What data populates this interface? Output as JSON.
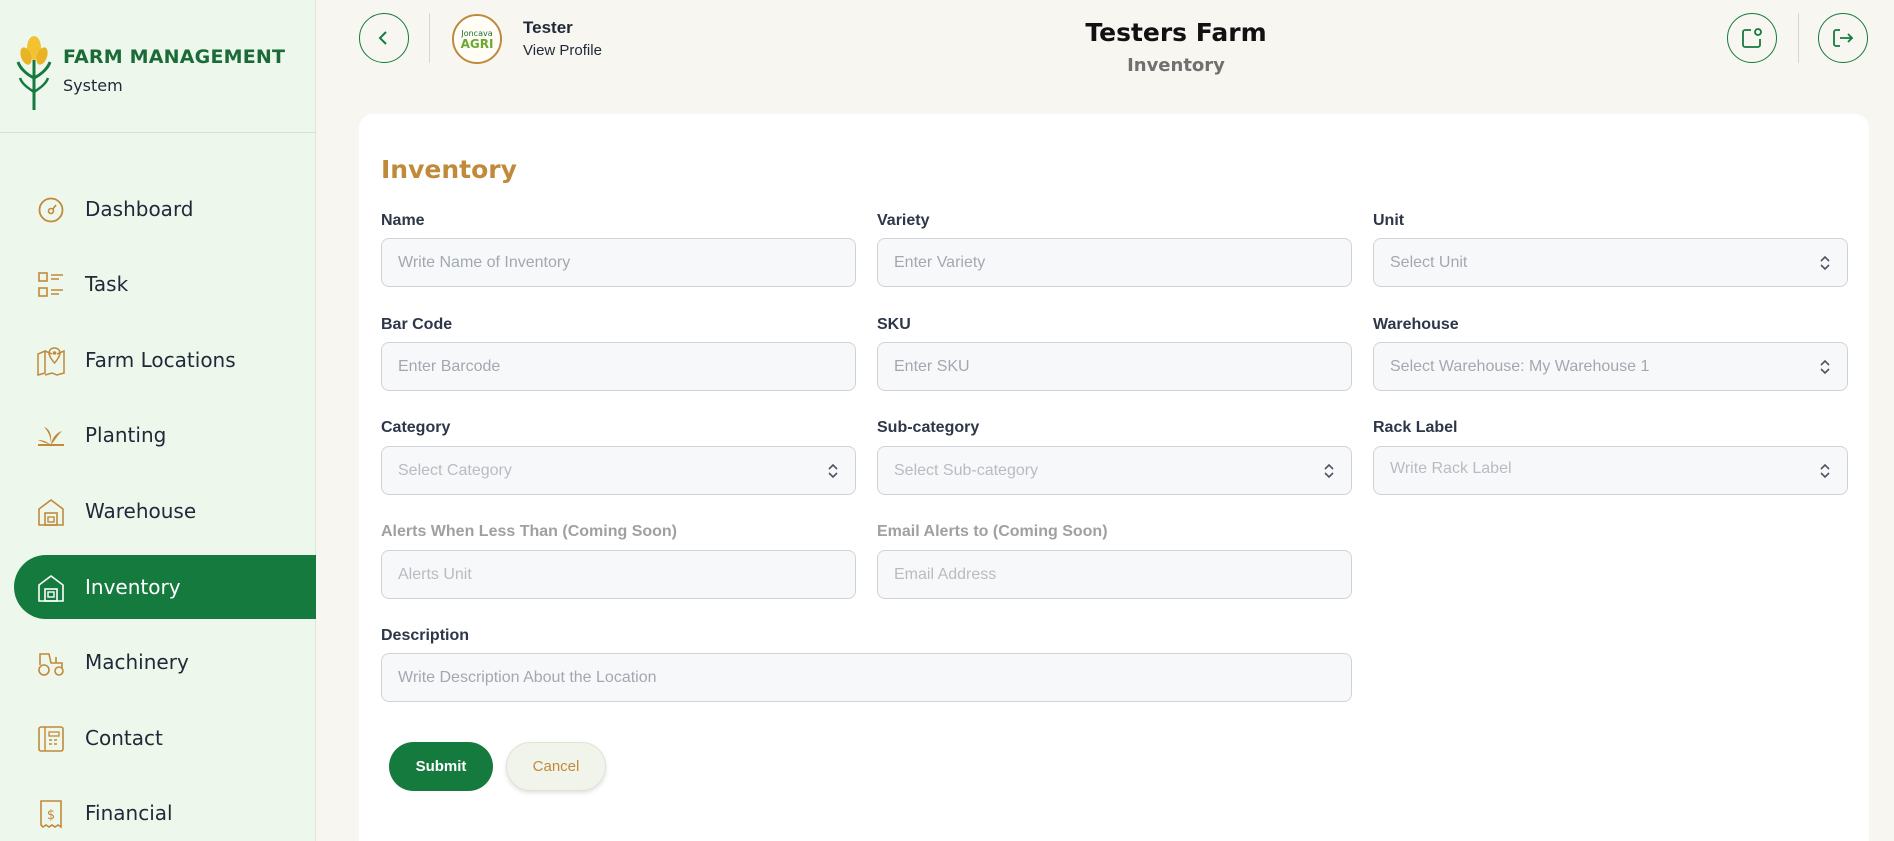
{
  "brand": {
    "title": "FARM MANAGEMENT",
    "subtitle": "System",
    "accent": "#157a3e",
    "gold": "#c08a3a"
  },
  "sidebar": {
    "items": [
      {
        "label": "Dashboard",
        "icon": "dashboard-gauge-icon",
        "active": false
      },
      {
        "label": "Task",
        "icon": "task-list-icon",
        "active": false
      },
      {
        "label": "Farm Locations",
        "icon": "map-pin-icon",
        "active": false
      },
      {
        "label": "Planting",
        "icon": "sprout-icon",
        "active": false
      },
      {
        "label": "Warehouse",
        "icon": "warehouse-icon",
        "active": false
      },
      {
        "label": "Inventory",
        "icon": "inventory-icon",
        "active": true
      },
      {
        "label": "Machinery",
        "icon": "tractor-icon",
        "active": false
      },
      {
        "label": "Contact",
        "icon": "contact-icon",
        "active": false
      },
      {
        "label": "Financial",
        "icon": "receipt-dollar-icon",
        "active": false
      }
    ]
  },
  "header": {
    "user_name": "Tester",
    "view_profile": "View Profile",
    "avatar_text_top": "Joncava",
    "avatar_text_bottom": "AGRI",
    "farm_title": "Testers Farm",
    "page_subtitle": "Inventory"
  },
  "form": {
    "title": "Inventory",
    "name": {
      "label": "Name",
      "placeholder": "Write Name of Inventory"
    },
    "variety": {
      "label": "Variety",
      "placeholder": "Enter Variety"
    },
    "unit": {
      "label": "Unit",
      "placeholder": "Select Unit"
    },
    "barcode": {
      "label": "Bar Code",
      "placeholder": "Enter Barcode"
    },
    "sku": {
      "label": "SKU",
      "placeholder": "Enter SKU"
    },
    "warehouse": {
      "label": "Warehouse",
      "placeholder": "Select Warehouse: My Warehouse 1"
    },
    "category": {
      "label": "Category",
      "placeholder": "Select Category"
    },
    "subcategory": {
      "label": "Sub-category",
      "placeholder": "Select Sub-category"
    },
    "rack": {
      "label": "Rack Label",
      "placeholder": "Write Rack Label"
    },
    "alerts": {
      "label": "Alerts When Less Than (Coming Soon)",
      "placeholder": "Alerts Unit"
    },
    "email_alerts": {
      "label": "Email Alerts to (Coming Soon)",
      "placeholder": "Email Address"
    },
    "description": {
      "label": "Description",
      "placeholder": "Write Description About the Location"
    },
    "submit": "Submit",
    "cancel": "Cancel"
  }
}
